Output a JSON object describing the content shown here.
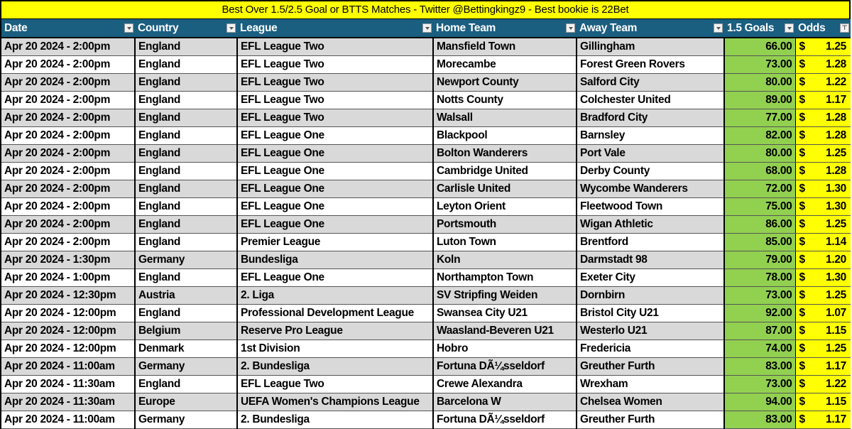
{
  "title": "Best Over 1.5/2.5 Goal or BTTS  Matches - Twitter @Bettingkingz9 - Best bookie is 22Bet",
  "colors": {
    "title_bg": "#ffff00",
    "header_bg": "#1a5e80",
    "goals_bg": "#92d050",
    "odds_bg": "#ffff00",
    "row_alt_bg": "#d9d9d9"
  },
  "headers": [
    {
      "label": "Date",
      "filter": "filter-dropdown-icon"
    },
    {
      "label": "Country",
      "filter": "filter-dropdown-icon"
    },
    {
      "label": "League",
      "filter": "filter-dropdown-icon"
    },
    {
      "label": "Home Team",
      "filter": "filter-dropdown-icon"
    },
    {
      "label": "Away Team",
      "filter": "filter-dropdown-icon"
    },
    {
      "label": "1.5 Goals",
      "filter": "filter-dropdown-icon"
    },
    {
      "label": "Odds",
      "filter": "filter-sort-active-icon"
    }
  ],
  "currency_symbol": "$",
  "rows": [
    {
      "date": "Apr 20 2024 - 2:00pm",
      "country": "England",
      "league": "EFL League Two",
      "home": "Mansfield Town",
      "away": "Gillingham",
      "goals": "66.00",
      "odds": "1.25"
    },
    {
      "date": "Apr 20 2024 - 2:00pm",
      "country": "England",
      "league": "EFL League Two",
      "home": "Morecambe",
      "away": "Forest Green Rovers",
      "goals": "73.00",
      "odds": "1.28"
    },
    {
      "date": "Apr 20 2024 - 2:00pm",
      "country": "England",
      "league": "EFL League Two",
      "home": "Newport County",
      "away": "Salford City",
      "goals": "80.00",
      "odds": "1.22"
    },
    {
      "date": "Apr 20 2024 - 2:00pm",
      "country": "England",
      "league": "EFL League Two",
      "home": "Notts County",
      "away": "Colchester United",
      "goals": "89.00",
      "odds": "1.17"
    },
    {
      "date": "Apr 20 2024 - 2:00pm",
      "country": "England",
      "league": "EFL League Two",
      "home": "Walsall",
      "away": "Bradford City",
      "goals": "77.00",
      "odds": "1.28"
    },
    {
      "date": "Apr 20 2024 - 2:00pm",
      "country": "England",
      "league": "EFL League One",
      "home": "Blackpool",
      "away": "Barnsley",
      "goals": "82.00",
      "odds": "1.28"
    },
    {
      "date": "Apr 20 2024 - 2:00pm",
      "country": "England",
      "league": "EFL League One",
      "home": "Bolton Wanderers",
      "away": "Port Vale",
      "goals": "80.00",
      "odds": "1.25"
    },
    {
      "date": "Apr 20 2024 - 2:00pm",
      "country": "England",
      "league": "EFL League One",
      "home": "Cambridge United",
      "away": "Derby County",
      "goals": "68.00",
      "odds": "1.28"
    },
    {
      "date": "Apr 20 2024 - 2:00pm",
      "country": "England",
      "league": "EFL League One",
      "home": "Carlisle United",
      "away": "Wycombe Wanderers",
      "goals": "72.00",
      "odds": "1.30"
    },
    {
      "date": "Apr 20 2024 - 2:00pm",
      "country": "England",
      "league": "EFL League One",
      "home": "Leyton Orient",
      "away": "Fleetwood Town",
      "goals": "75.00",
      "odds": "1.30"
    },
    {
      "date": "Apr 20 2024 - 2:00pm",
      "country": "England",
      "league": "EFL League One",
      "home": "Portsmouth",
      "away": "Wigan Athletic",
      "goals": "86.00",
      "odds": "1.25"
    },
    {
      "date": "Apr 20 2024 - 2:00pm",
      "country": "England",
      "league": "Premier League",
      "home": "Luton Town",
      "away": "Brentford",
      "goals": "85.00",
      "odds": "1.14"
    },
    {
      "date": "Apr 20 2024 - 1:30pm",
      "country": "Germany",
      "league": "Bundesliga",
      "home": "Koln",
      "away": "Darmstadt 98",
      "goals": "79.00",
      "odds": "1.20"
    },
    {
      "date": "Apr 20 2024 - 1:00pm",
      "country": "England",
      "league": "EFL League One",
      "home": "Northampton Town",
      "away": "Exeter City",
      "goals": "78.00",
      "odds": "1.30"
    },
    {
      "date": "Apr 20 2024 - 12:30pm",
      "country": "Austria",
      "league": "2. Liga",
      "home": "SV Stripfing Weiden",
      "away": "Dornbirn",
      "goals": "73.00",
      "odds": "1.25"
    },
    {
      "date": "Apr 20 2024 - 12:00pm",
      "country": "England",
      "league": "Professional Development League",
      "home": "Swansea City U21",
      "away": "Bristol City U21",
      "goals": "92.00",
      "odds": "1.07"
    },
    {
      "date": "Apr 20 2024 - 12:00pm",
      "country": "Belgium",
      "league": "Reserve Pro League",
      "home": "Waasland-Beveren U21",
      "away": "Westerlo U21",
      "goals": "87.00",
      "odds": "1.15"
    },
    {
      "date": "Apr 20 2024 - 12:00pm",
      "country": "Denmark",
      "league": "1st Division",
      "home": "Hobro",
      "away": "Fredericia",
      "goals": "74.00",
      "odds": "1.25"
    },
    {
      "date": "Apr 20 2024 - 11:00am",
      "country": "Germany",
      "league": "2. Bundesliga",
      "home": "Fortuna DÃ¼sseldorf",
      "away": "Greuther Furth",
      "goals": "83.00",
      "odds": "1.17"
    },
    {
      "date": "Apr 20 2024 - 11:30am",
      "country": "England",
      "league": "EFL League Two",
      "home": "Crewe Alexandra",
      "away": "Wrexham",
      "goals": "73.00",
      "odds": "1.22"
    },
    {
      "date": "Apr 20 2024 - 11:30am",
      "country": "Europe",
      "league": "UEFA Women's Champions League",
      "home": "Barcelona W",
      "away": "Chelsea Women",
      "goals": "94.00",
      "odds": "1.15"
    },
    {
      "date": "Apr 20 2024 - 11:00am",
      "country": "Germany",
      "league": "2. Bundesliga",
      "home": "Fortuna DÃ¼sseldorf",
      "away": "Greuther Furth",
      "goals": "83.00",
      "odds": "1.17"
    }
  ]
}
